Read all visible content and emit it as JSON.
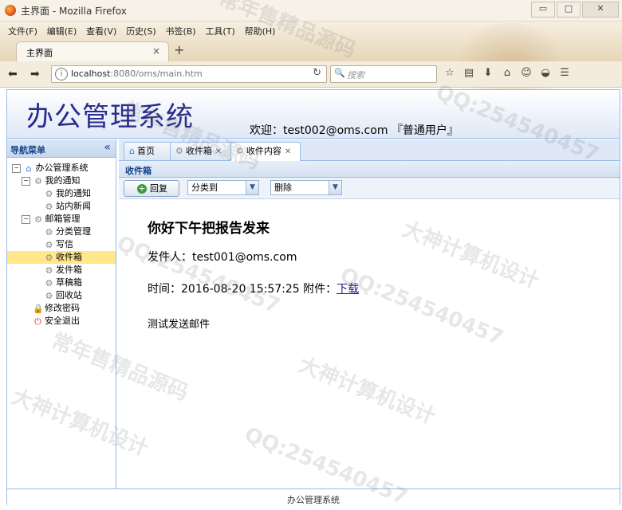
{
  "browser": {
    "window_title": "主界面 - Mozilla Firefox",
    "menu": [
      "文件(F)",
      "编辑(E)",
      "查看(V)",
      "历史(S)",
      "书签(B)",
      "工具(T)",
      "帮助(H)"
    ],
    "tab_title": "主界面",
    "tab_close": "×",
    "new_tab": "+",
    "url_host": "localhost",
    "url_rest": ":8080/oms/main.htm",
    "search_placeholder": "搜索",
    "win_min": "▭",
    "win_max": "□",
    "win_close": "✕"
  },
  "app": {
    "title": "办公管理系统",
    "welcome": "欢迎：test002@oms.com 『普通用户』",
    "footer": "办公管理系统"
  },
  "sidebar": {
    "title": "导航菜单",
    "collapse": "«",
    "tree": [
      {
        "label": "办公管理系统",
        "level": 0,
        "icon": "house-icon",
        "exp": "−"
      },
      {
        "label": "我的通知",
        "level": 1,
        "icon": "gear-icon",
        "exp": "−"
      },
      {
        "label": "我的通知",
        "level": 2,
        "icon": "gear-icon"
      },
      {
        "label": "站内新闻",
        "level": 2,
        "icon": "gear-icon"
      },
      {
        "label": "邮箱管理",
        "level": 1,
        "icon": "gear-icon",
        "exp": "−"
      },
      {
        "label": "分类管理",
        "level": 2,
        "icon": "gear-icon"
      },
      {
        "label": "写信",
        "level": 2,
        "icon": "gear-icon"
      },
      {
        "label": "收件箱",
        "level": 2,
        "icon": "gear-icon",
        "selected": true
      },
      {
        "label": "发件箱",
        "level": 2,
        "icon": "gear-icon"
      },
      {
        "label": "草稿箱",
        "level": 2,
        "icon": "gear-icon"
      },
      {
        "label": "回收站",
        "level": 2,
        "icon": "gear-icon"
      },
      {
        "label": "修改密码",
        "level": 1,
        "icon": "lock-icon"
      },
      {
        "label": "安全退出",
        "level": 1,
        "icon": "exit-icon"
      }
    ]
  },
  "tabs": [
    {
      "label": "首页",
      "icon": "home-icon",
      "closable": false
    },
    {
      "label": "收件箱",
      "icon": "gear-icon",
      "closable": true
    },
    {
      "label": "收件内容",
      "icon": "gear-icon",
      "closable": true,
      "active": true
    }
  ],
  "panel": {
    "title": "收件箱",
    "reply_label": "回复",
    "classify_value": "分类到",
    "delete_value": "删除"
  },
  "mail": {
    "subject": "你好下午把报告发来",
    "from_label": "发件人：",
    "from": "test001@oms.com",
    "time_label": "时间：",
    "time": "2016-08-20 15:57:25",
    "attach_label": "附件：",
    "attach_link": "下载",
    "body": "测试发送邮件"
  },
  "watermarks": [
    "常年售精品源码",
    "QQ:254540457",
    "大神计算机设计",
    "QQ:254540457",
    "常年售精品源码",
    "大神计算机设计",
    "QQ:254540457",
    "常年售精品源码",
    "QQ:254540457",
    "大神计算机设计"
  ],
  "colors": {
    "accent": "#15428b",
    "selected": "#ffe78a",
    "border": "#99bbe8"
  }
}
